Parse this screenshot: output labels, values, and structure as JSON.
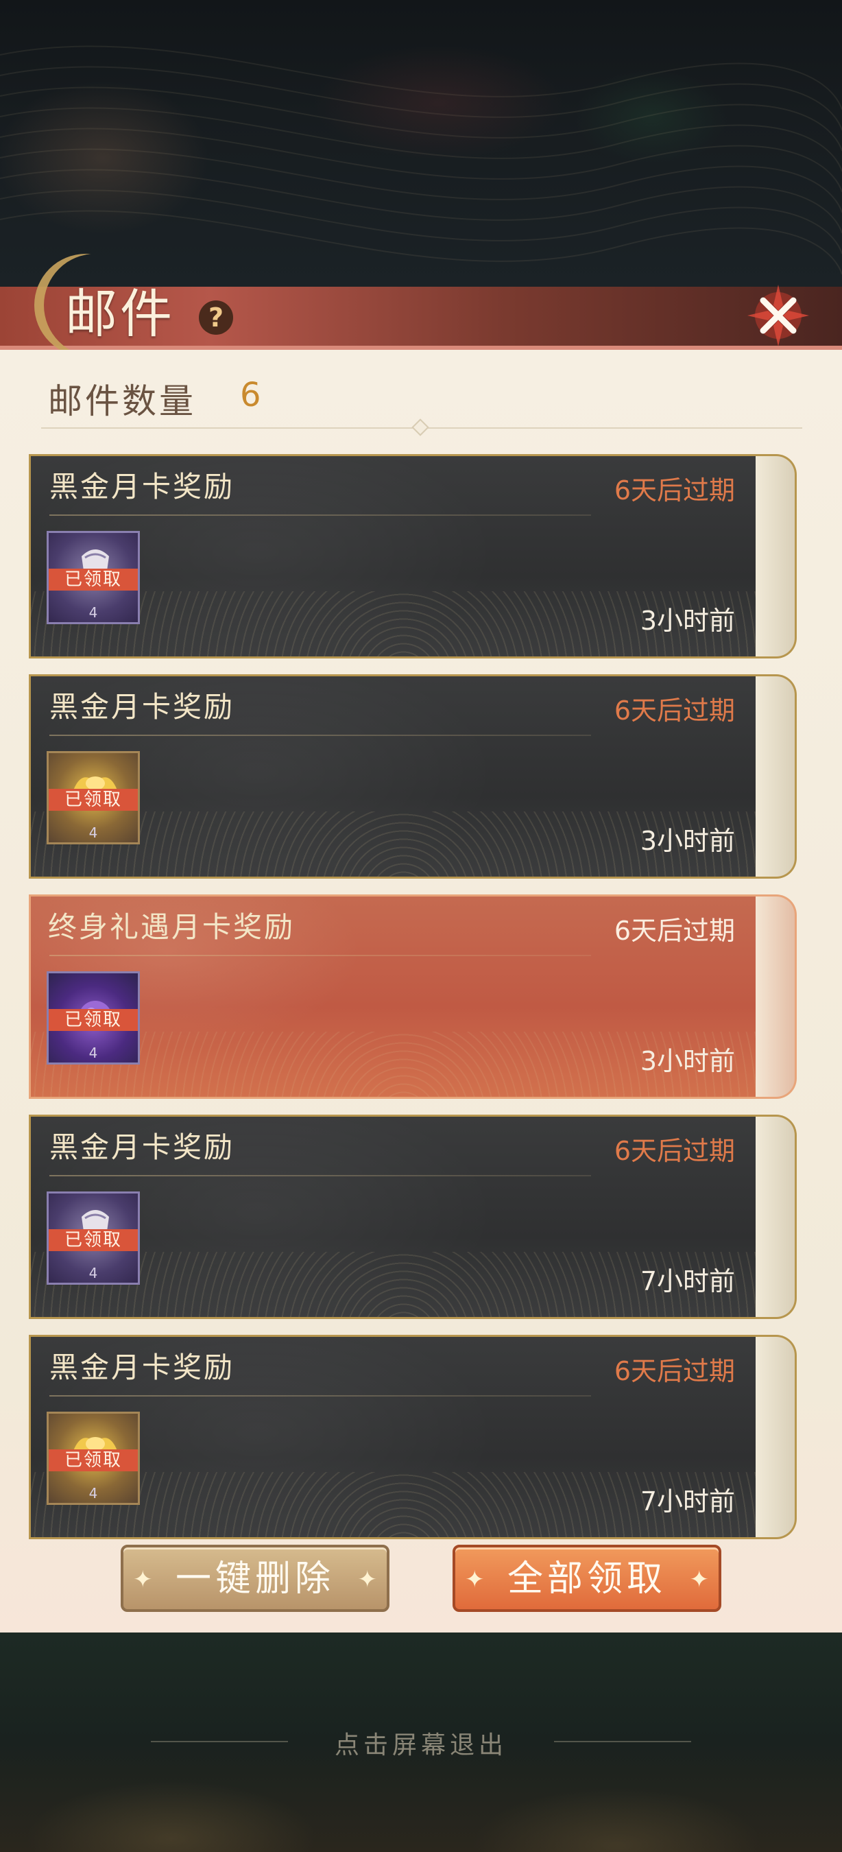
{
  "header": {
    "title": "邮件",
    "help_icon": "?"
  },
  "summary": {
    "count_label": "邮件数量",
    "count_value": "6"
  },
  "mails": [
    {
      "title": "黑金月卡奖励",
      "expire": "6天后过期",
      "time": "3小时前",
      "reward_icon": "pouch-icon",
      "status": "已领取",
      "quantity": "4"
    },
    {
      "title": "黑金月卡奖励",
      "expire": "6天后过期",
      "time": "3小时前",
      "reward_icon": "gold-ingot-icon",
      "status": "已领取",
      "quantity": "4"
    },
    {
      "title": "终身礼遇月卡奖励",
      "expire": "6天后过期",
      "time": "3小时前",
      "reward_icon": "purple-orb-icon",
      "status": "已领取",
      "quantity": "4"
    },
    {
      "title": "黑金月卡奖励",
      "expire": "6天后过期",
      "time": "7小时前",
      "reward_icon": "pouch-icon",
      "status": "已领取",
      "quantity": "4"
    },
    {
      "title": "黑金月卡奖励",
      "expire": "6天后过期",
      "time": "7小时前",
      "reward_icon": "gold-ingot-icon",
      "status": "已领取",
      "quantity": "4"
    }
  ],
  "actions": {
    "delete_all": "一键删除",
    "claim_all": "全部领取"
  },
  "footer": {
    "exit_hint": "点击屏幕退出"
  },
  "colors": {
    "title_bar": "#b5574a",
    "expire_text": "#e07a4a",
    "claim_button": "#e06b3b",
    "delete_button": "#c6a47a",
    "claimed_badge": "#d9553a"
  }
}
